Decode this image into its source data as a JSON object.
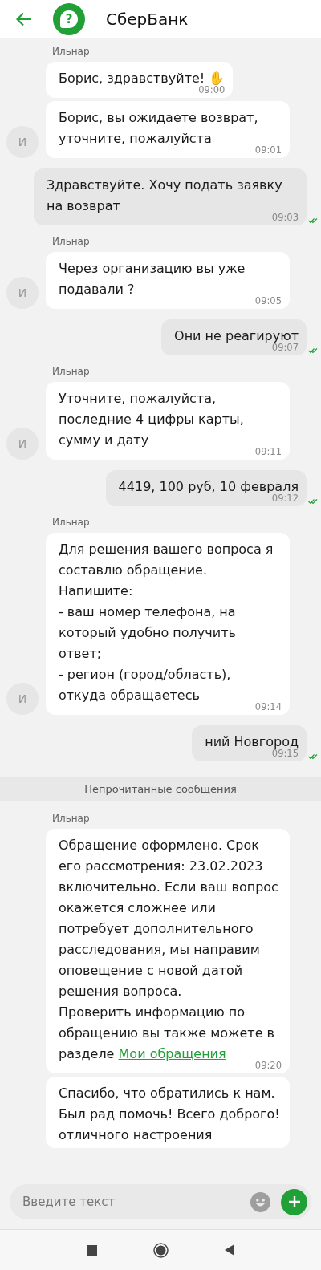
{
  "header": {
    "title": "СберБанк",
    "logo_glyph": "?"
  },
  "chat": [
    {
      "kind": "incoming",
      "sender": "Ильнар",
      "avatar": "И",
      "bubbles": [
        {
          "text": "Борис, здравствуйте! ✋",
          "time": "09:00"
        },
        {
          "text": "Борис, вы ожидаете возврат, уточните, пожалуйста",
          "time": "09:01"
        }
      ]
    },
    {
      "kind": "outgoing",
      "text": "Здравствуйте. Хочу подать заявку на возврат",
      "time": "09:03",
      "read": true
    },
    {
      "kind": "incoming",
      "sender": "Ильнар",
      "avatar": "И",
      "bubbles": [
        {
          "text": "Через организацию вы уже подавали ?",
          "time": "09:05"
        }
      ]
    },
    {
      "kind": "outgoing",
      "text": "Они не реагируют",
      "time": "09:07",
      "read": true
    },
    {
      "kind": "incoming",
      "sender": "Ильнар",
      "avatar": "И",
      "bubbles": [
        {
          "text": "Уточните, пожалуйста, последние 4 цифры карты, сумму и дату",
          "time": "09:11"
        }
      ]
    },
    {
      "kind": "outgoing",
      "text": "4419, 100 руб, 10 февраля",
      "time": "09:12",
      "read": true
    },
    {
      "kind": "incoming",
      "sender": "Ильнар",
      "avatar": "И",
      "bubbles": [
        {
          "text": "Для решения вашего вопроса я составлю обращение.\nНапишите:\n- ваш номер телефона, на который удобно получить ответ;\n- регион (город/область), откуда обращаетесь",
          "time": "09:14"
        }
      ]
    },
    {
      "kind": "outgoing",
      "text": "ний Новгород",
      "time": "09:15",
      "read": true
    },
    {
      "kind": "divider",
      "text": "Непрочитанные сообщения"
    },
    {
      "kind": "incoming",
      "sender": "Ильнар",
      "bubbles": [
        {
          "text": "Обращение оформлено. Срок его рассмотрения: 23.02.2023 включительно. Если ваш вопрос окажется сложнее или потребует дополнительного расследования, мы направим оповещение с новой датой решения вопроса.\nПроверить информацию по обращению вы также можете в разделе",
          "link": "Мои обращения",
          "time": "09:20"
        },
        {
          "text": "Спасибо, что обратились к нам. Был рад помочь! Всего доброго!отличного настроения"
        }
      ]
    }
  ],
  "input": {
    "placeholder": "Введите текст"
  }
}
